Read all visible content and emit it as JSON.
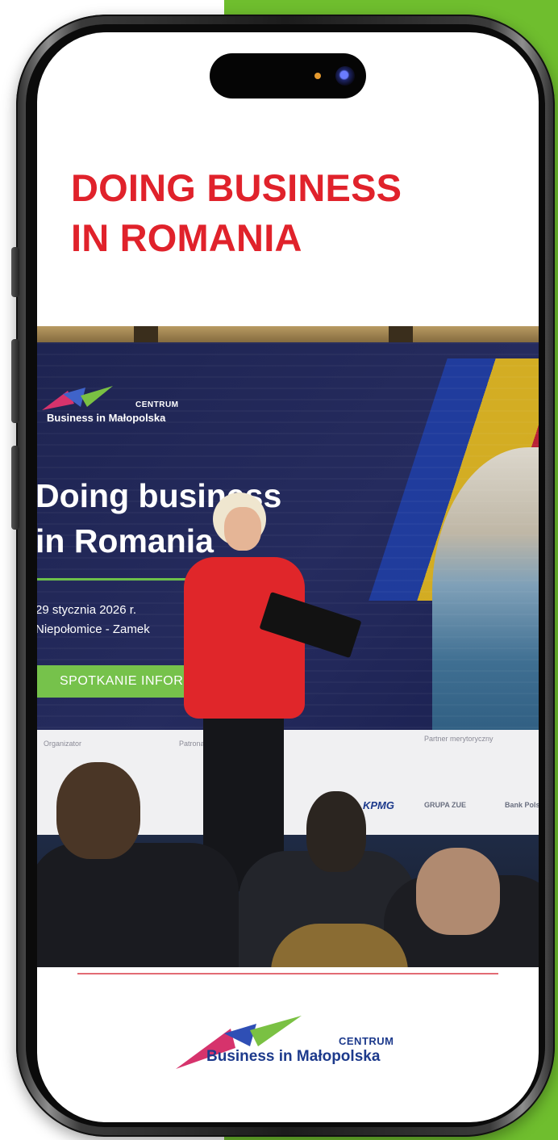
{
  "headline": {
    "line1": "DOING BUSINESS",
    "line2": "IN ROMANIA"
  },
  "event_screen": {
    "logo_top": "CENTRUM",
    "logo_name": "Business in Małopolska",
    "title_line1": "Doing business",
    "title_line2": "in Romania",
    "date": "29 stycznia 2026 r.",
    "place": "Niepołomice - Zamek",
    "cta": "SPOTKANIE INFORMACYJNE",
    "sponsor_labels": [
      "Organizator",
      "Patronat",
      "Partner merytoryczny"
    ],
    "sponsor_logos": [
      "KPMG",
      "GRUPA ZUE",
      "Bank Polski"
    ]
  },
  "footer": {
    "logo_top": "CENTRUM",
    "logo_name": "Business in Małopolska"
  },
  "colors": {
    "accent_red": "#e0222b",
    "brand_blue": "#1d3a8c",
    "brand_green": "#6fbe2e",
    "divider": "#e26b74"
  }
}
